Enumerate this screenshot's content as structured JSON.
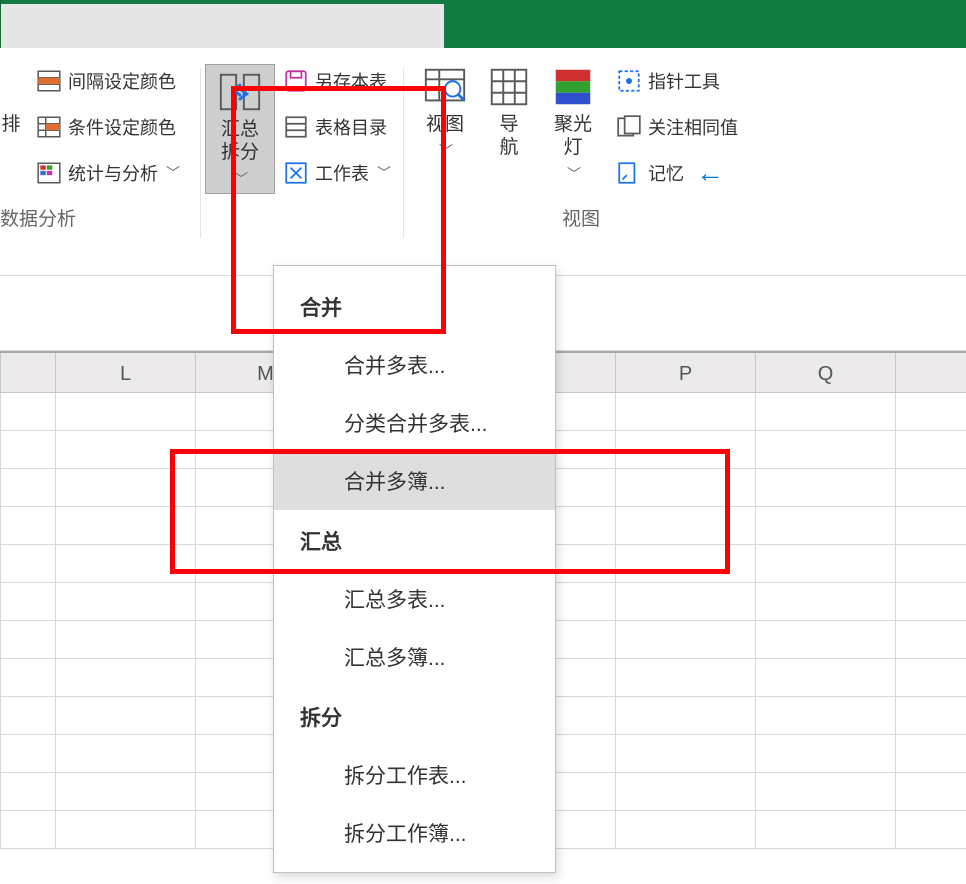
{
  "ribbon": {
    "group1": {
      "label": "数据分析",
      "sort_partial": "排",
      "interval_color": "间隔设定颜色",
      "cond_color": "条件设定颜色",
      "stats": "统计与分析"
    },
    "group2": {
      "summary_split": "汇总拆分",
      "save_sheet": "另存本表",
      "sheet_catalog": "表格目录",
      "worksheet": "工作表"
    },
    "group3": {
      "label": "视图",
      "view": "视图",
      "nav": "导航",
      "spotlight": "聚光灯",
      "pointer_tool": "指针工具",
      "follow_same": "关注相同值",
      "memory": "记忆"
    }
  },
  "dropdown": {
    "sec1": "合并",
    "merge_sheets": "合并多表...",
    "cat_merge_sheets": "分类合并多表...",
    "merge_books": "合并多簿...",
    "sec2": "汇总",
    "sum_sheets": "汇总多表...",
    "sum_books": "汇总多簿...",
    "sec3": "拆分",
    "split_sheet": "拆分工作表...",
    "split_book": "拆分工作簿..."
  },
  "columns": {
    "L": "L",
    "M": "M",
    "P": "P",
    "Q": "Q"
  }
}
